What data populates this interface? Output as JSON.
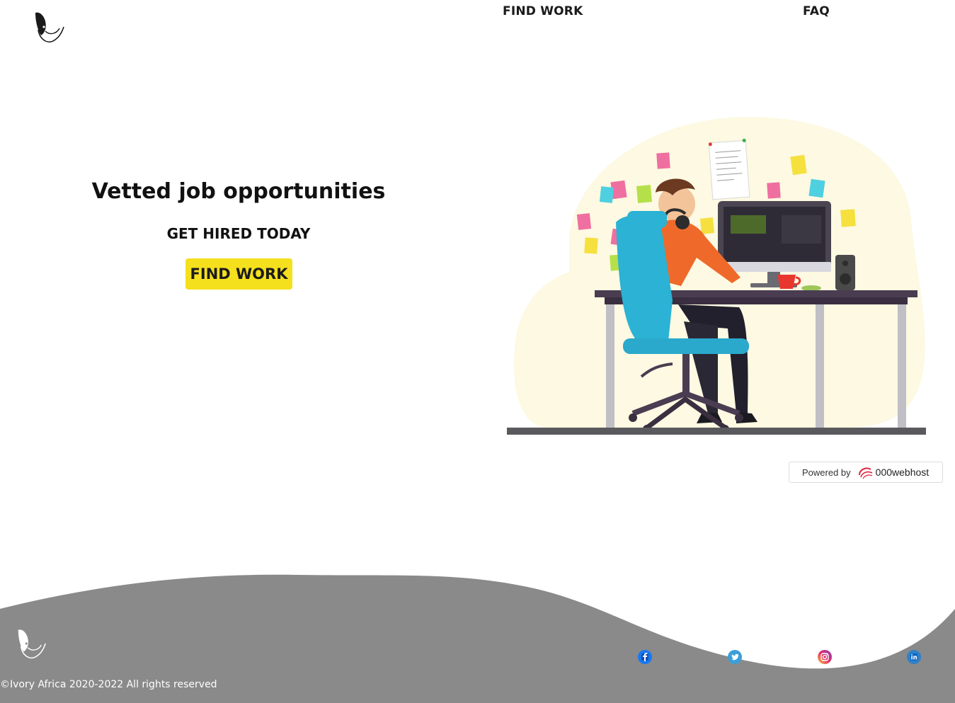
{
  "header": {
    "logo_icon": "ivory-africa-bird-logo",
    "nav": [
      {
        "label": "FIND WORK"
      },
      {
        "label": "FAQ"
      }
    ]
  },
  "hero": {
    "title": "Vetted job opportunities",
    "subtitle": "GET HIRED TODAY",
    "cta_label": "FIND WORK",
    "cta_color": "#f5e01e",
    "illustration_icon": "developer-at-desk-illustration"
  },
  "badge": {
    "text": "Powered by",
    "brand": "000webhost"
  },
  "footer": {
    "background_color": "#8a8a8a",
    "logo_icon": "ivory-africa-bird-logo",
    "copyright": "©Ivory Africa 2020-2022 All rights reserved",
    "social": [
      {
        "icon": "facebook-icon",
        "color": "#1877f2"
      },
      {
        "icon": "twitter-icon",
        "color": "#1da1f2"
      },
      {
        "icon": "instagram-icon",
        "color": "#c13584"
      },
      {
        "icon": "linkedin-icon",
        "color": "#0a66c2"
      }
    ]
  }
}
